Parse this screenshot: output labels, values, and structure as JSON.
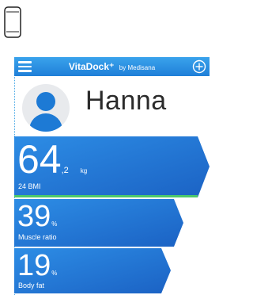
{
  "device": {
    "icon": "smartphone-icon"
  },
  "header": {
    "title": "VitaDock⁺",
    "subtitle": "by Medisana",
    "menu_icon": "hamburger-menu-icon",
    "add_icon": "plus-circle-icon"
  },
  "profile": {
    "name": "Hanna",
    "avatar_icon": "person-avatar-icon"
  },
  "metrics": [
    {
      "id": "bmi",
      "value": "64",
      "decimal": ",2",
      "unit": "kg",
      "label": "24 BMI"
    },
    {
      "id": "muscle",
      "value": "39",
      "unit": "%",
      "label": "Muscle ratio"
    },
    {
      "id": "fat",
      "value": "19",
      "unit": "%",
      "label": "Body fat"
    }
  ],
  "colors": {
    "header_blue": "#2a8fe3",
    "tile_blue": "#1f6fcf",
    "accent_green": "#4cc96a",
    "avatar_blue": "#1d7ad5"
  }
}
